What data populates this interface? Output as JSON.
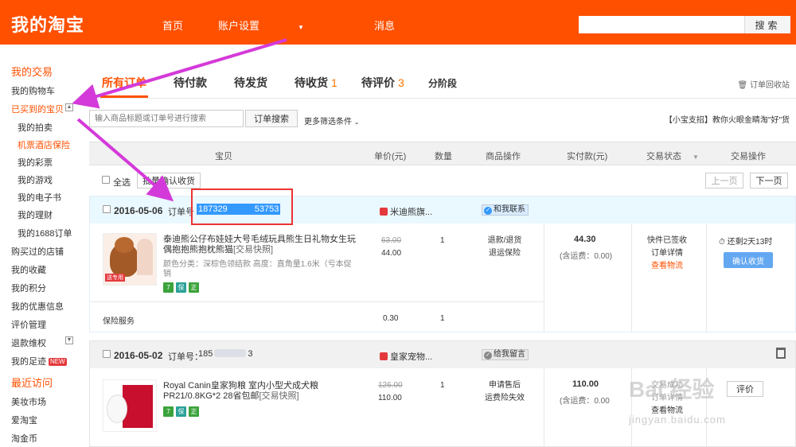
{
  "header": {
    "logo": "我的淘宝",
    "nav": [
      "首页",
      "账户设置",
      "消息"
    ],
    "search_placeholder": "",
    "search_button": "搜索"
  },
  "sidebar": {
    "my_trade": "我的交易",
    "cart": "我的购物车",
    "bought": "已买到的宝贝",
    "bought_toggle": "▲",
    "sub": [
      "我的拍卖",
      "机票酒店保险",
      "我的彩票",
      "我的游戏",
      "我的电子书",
      "我的理财",
      "我的1688订单"
    ],
    "items": [
      "购买过的店铺",
      "我的收藏",
      "我的积分",
      "我的优惠信息",
      "评价管理",
      "退款维权",
      "我的足迹"
    ],
    "refund_toggle": "▼",
    "new_badge": "NEW",
    "recent": "最近访问",
    "recent_items": [
      "美妆市场",
      "爱淘宝",
      "淘金币"
    ]
  },
  "tabs": [
    {
      "label": "所有订单",
      "count": ""
    },
    {
      "label": "待付款",
      "count": ""
    },
    {
      "label": "待发货",
      "count": ""
    },
    {
      "label": "待收货",
      "count": "1"
    },
    {
      "label": "待评价",
      "count": "3"
    },
    {
      "label": "分阶段",
      "count": ""
    }
  ],
  "recycle": "订单回收站",
  "filter": {
    "placeholder": "输入商品标题或订单号进行搜索",
    "button": "订单搜索",
    "more": "更多筛选条件",
    "tip": "【小宝支招】教你火眼金睛淘\"好\"货"
  },
  "columns": [
    "宝贝",
    "单价(元)",
    "数量",
    "商品操作",
    "实付款(元)",
    "交易状态",
    "交易操作"
  ],
  "select_all": "全选",
  "batch_confirm": "批量确认收货",
  "pager": {
    "prev": "上一页",
    "next": "下一页"
  },
  "orders": [
    {
      "date": "2016-05-06",
      "order_label": "订单号",
      "order_no_a": "187329",
      "order_no_b": "53753",
      "shop": "米迪熊旗...",
      "contact": "和我联系",
      "title": "泰迪熊公仔布娃娃大号毛绒玩具熊生日礼物女生玩偶抱抱熊抱枕熊猫",
      "snapshot": "[交易快照]",
      "sku": "颜色分类：深棕色领结款   高度：直角量1.6米（亏本促销",
      "thumb_tag": "送专用",
      "badges": [
        "7",
        "保",
        "正"
      ],
      "price_old": "63.00",
      "price_new": "44.00",
      "qty": "1",
      "ops": [
        "退款/退货",
        "退运保险"
      ],
      "paid": "44.30",
      "ship": "(含运费：0.00)",
      "status": "快件已签收",
      "status_detail": "订单详情",
      "status_link": "查看物流",
      "remain": "还剩2天13时",
      "confirm": "确认收货",
      "ins_label": "保险服务",
      "ins_price": "0.30",
      "ins_qty": "1"
    },
    {
      "date": "2016-05-02",
      "order_label": "订单号：",
      "order_no_a": "185",
      "order_no_b": "3",
      "shop": "皇家宠物...",
      "contact": "给我留言",
      "title": "Royal Canin皇家狗粮 室内小型犬成犬粮PR21/0.8KG*2 28省包邮",
      "snapshot": "[交易快照]",
      "badges": [
        "7",
        "保",
        "正"
      ],
      "price_old": "126.00",
      "price_new": "110.00",
      "qty": "1",
      "ops": [
        "申请售后",
        "运费险失效"
      ],
      "paid": "110.00",
      "ship": "(含运费：0.00",
      "status": "交易成功",
      "status_detail": "订单详情",
      "status_link": "查看物流",
      "action": "评价"
    }
  ],
  "watermark": "Bai 经验",
  "watermark_url": "jingyan.baidu.com",
  "colors": {
    "brand": "#ff5000",
    "highlight": "#3399ff",
    "annotation": "#d43ad9"
  }
}
